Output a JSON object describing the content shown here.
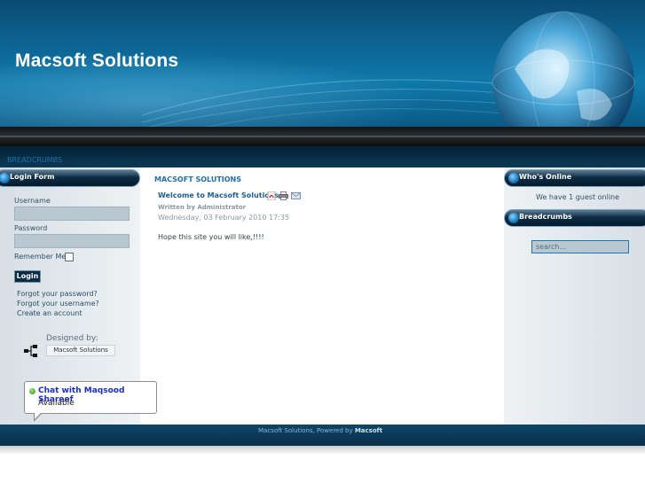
{
  "header": {
    "site_title": "Macsoft Solutions"
  },
  "breadcrumbs_bar": {
    "label": "BREADCRUMBS"
  },
  "login_module": {
    "title": "Login Form",
    "username_label": "Username",
    "password_label": "Password",
    "remember_label": "Remember Me",
    "remember_checked": false,
    "login_button": "Login",
    "links": [
      "Forgot your password?",
      "Forgot your username?",
      "Create an account"
    ]
  },
  "designer": {
    "label": "Designed by:",
    "name": "Macsoft Solutions",
    "icon": "network-icon"
  },
  "chat": {
    "name": "Chat with Maqsood Shareef",
    "status": "Available",
    "status_color": "#2e8f18"
  },
  "main": {
    "heading": "MACSOFT SOLUTIONS",
    "article_title": "Welcome to Macsoft Solutions",
    "article_icons": [
      "pdf-icon",
      "print-icon",
      "email-icon"
    ],
    "author": "Written by Administrator",
    "date": "Wednesday, 03 February 2010 17:35",
    "body": "Hope this site you will like,!!!!"
  },
  "right": {
    "online_title": "Who's Online",
    "online_text": "We have 1 guest online",
    "breadcrumbs_title": "Breadcrumbs",
    "search_placeholder": "search..."
  },
  "footer": {
    "text": "Macsoft Solutions, Powered by",
    "brand": "Macsoft"
  },
  "colors": {
    "accent": "#1a6fb0",
    "header_bg": "#0d6493",
    "module_head": "#0d2c44"
  }
}
